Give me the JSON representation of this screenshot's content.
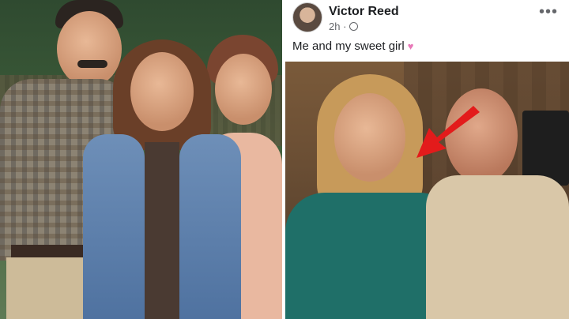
{
  "post": {
    "author_name": "Victor Reed",
    "time": "2h ·",
    "caption": "Me and my sweet girl",
    "caption_emoji": "♥",
    "more_icon": "•••"
  },
  "colors": {
    "arrow": "#e31b1b",
    "heart": "#e879b8"
  },
  "icons": {
    "privacy": "globe-icon",
    "more": "more-options-icon",
    "arrow": "red-arrow-icon"
  }
}
